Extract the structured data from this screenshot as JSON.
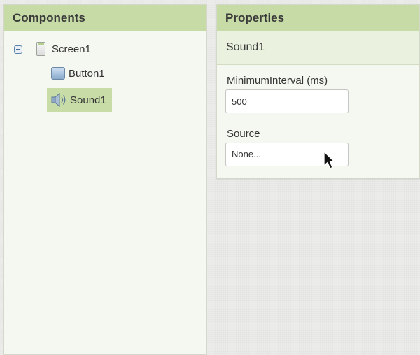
{
  "components": {
    "title": "Components",
    "tree": {
      "root": "Screen1",
      "children": [
        "Button1",
        "Sound1"
      ],
      "selected": "Sound1"
    }
  },
  "properties": {
    "title": "Properties",
    "component_name": "Sound1",
    "fields": {
      "minimum_interval": {
        "label": "MinimumInterval (ms)",
        "value": "500"
      },
      "source": {
        "label": "Source",
        "value": "None..."
      }
    }
  },
  "icons": [
    "collapse-icon",
    "screen-icon",
    "button-icon",
    "sound-icon",
    "mouse-cursor-icon"
  ],
  "colors": {
    "header_green": "#c6dba6",
    "selection_green": "#c8dca7",
    "panel_bg": "#f5f7f1"
  }
}
